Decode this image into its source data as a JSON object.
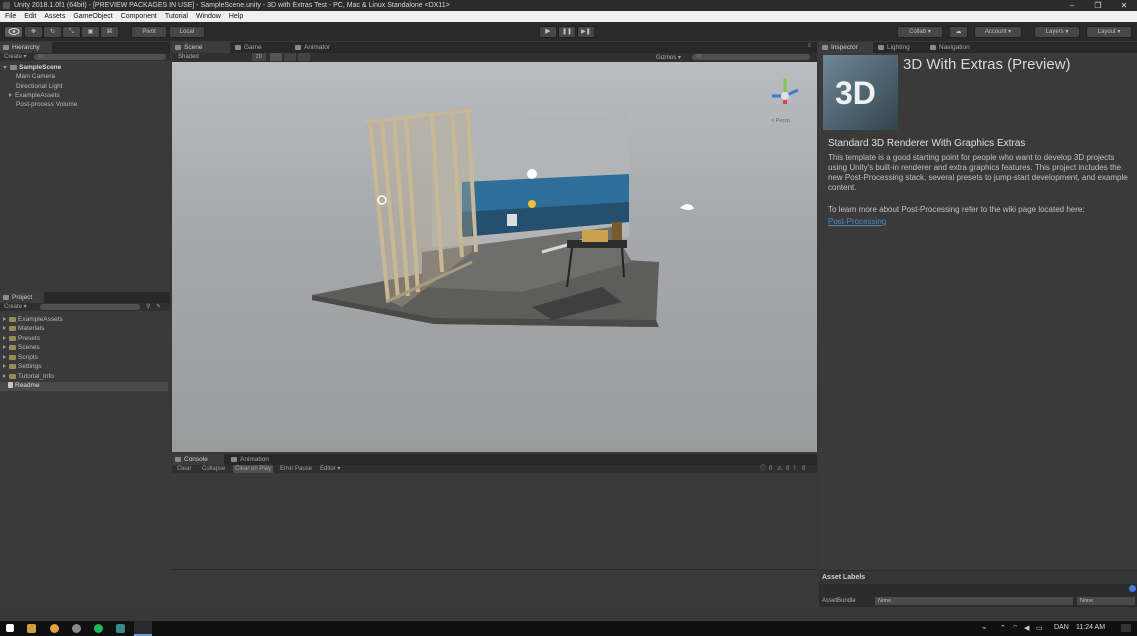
{
  "window": {
    "title": "Unity 2018.1.0f1 (64bit) - [PREVIEW PACKAGES IN USE] - SampleScene.unity - 3D with Extras Test - PC, Mac & Linux Standalone <DX11>",
    "minimize": "–",
    "maximize": "❐",
    "close": "✕"
  },
  "menu": [
    "File",
    "Edit",
    "Assets",
    "GameObject",
    "Component",
    "Tutorial",
    "Window",
    "Help"
  ],
  "toolbar": {
    "pivot": "Pivot",
    "local": "Local",
    "play": "▶",
    "pause": "❚❚",
    "step": "▶❚",
    "collab": "Collab ▾",
    "account": "Account ▾",
    "layers": "Layers ▾",
    "layout": "Layout ▾"
  },
  "hierarchy": {
    "tab": "Hierarchy",
    "create": "Create ▾",
    "search_placeholder": "All",
    "scene": "SampleScene",
    "items": [
      "Main Camera",
      "Directional Light",
      "ExampleAssets",
      "Post-process Volume"
    ]
  },
  "project": {
    "tab": "Project",
    "create": "Create ▾",
    "items": [
      "ExampleAssets",
      "Materials",
      "Presets",
      "Scenes",
      "Scripts",
      "Settings",
      "Tutorial_Info"
    ],
    "readme": "Readme"
  },
  "scene_view": {
    "tabs": [
      "Scene",
      "Game",
      "Animator"
    ],
    "shading": "Shaded",
    "mode": "2D",
    "gizmos": "Gizmos ▾",
    "search_placeholder": "All",
    "persp": "< Persp"
  },
  "console": {
    "tabs": [
      "Console",
      "Animation"
    ],
    "buttons": [
      "Clear",
      "Collapse",
      "Clear on Play",
      "Error Pause",
      "Editor ▾"
    ],
    "counts": [
      "0",
      "0",
      "0"
    ]
  },
  "inspector": {
    "tabs": [
      "Inspector",
      "Lighting",
      "Navigation"
    ],
    "title": "3D With Extras (Preview)",
    "thumb_text": "3D",
    "heading": "Standard 3D Renderer With Graphics Extras",
    "body": "This template is a good starting point for people who want to develop 3D projects using Unity's built-in renderer and extra graphics features. This project includes the new Post-Processing stack, several presets to jump-start development, and example content.",
    "link_text": "To learn more about Post-Processing refer to the wiki page located here:",
    "link": "Post-Processing",
    "asset_labels": "Asset Labels",
    "asset_bundle": "AssetBundle",
    "bundle_value": "None",
    "variant_value": "None"
  },
  "taskbar": {
    "lang": "DAN",
    "time": "11:24 AM"
  },
  "colors": {
    "accent": "#3e7dd8",
    "link": "#4f86c6"
  }
}
